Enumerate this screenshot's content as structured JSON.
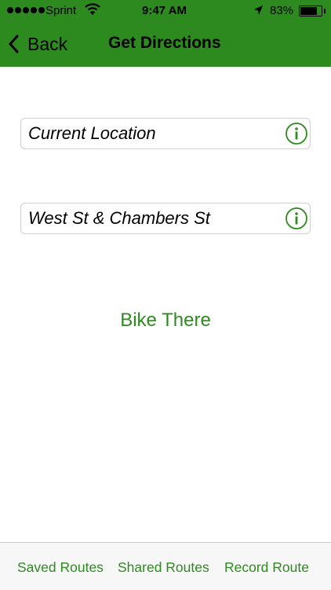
{
  "colors": {
    "accent": "#2d8a1f",
    "link_text": "#2e8a1f",
    "tab_bar_bg": "#f7f7f7"
  },
  "status_bar": {
    "carrier": "Sprint",
    "time": "9:47 AM",
    "battery": "83%",
    "battery_level": 0.83
  },
  "nav": {
    "back_label": "Back",
    "title": "Get Directions"
  },
  "form": {
    "start": {
      "value": "Current Location",
      "icon": "info-icon"
    },
    "end": {
      "value": "West St & Chambers St",
      "icon": "info-icon"
    }
  },
  "action": {
    "label": "Bike There"
  },
  "tab_bar": {
    "items": [
      {
        "label": "Saved Routes"
      },
      {
        "label": "Shared Routes"
      },
      {
        "label": "Record Route"
      }
    ]
  }
}
